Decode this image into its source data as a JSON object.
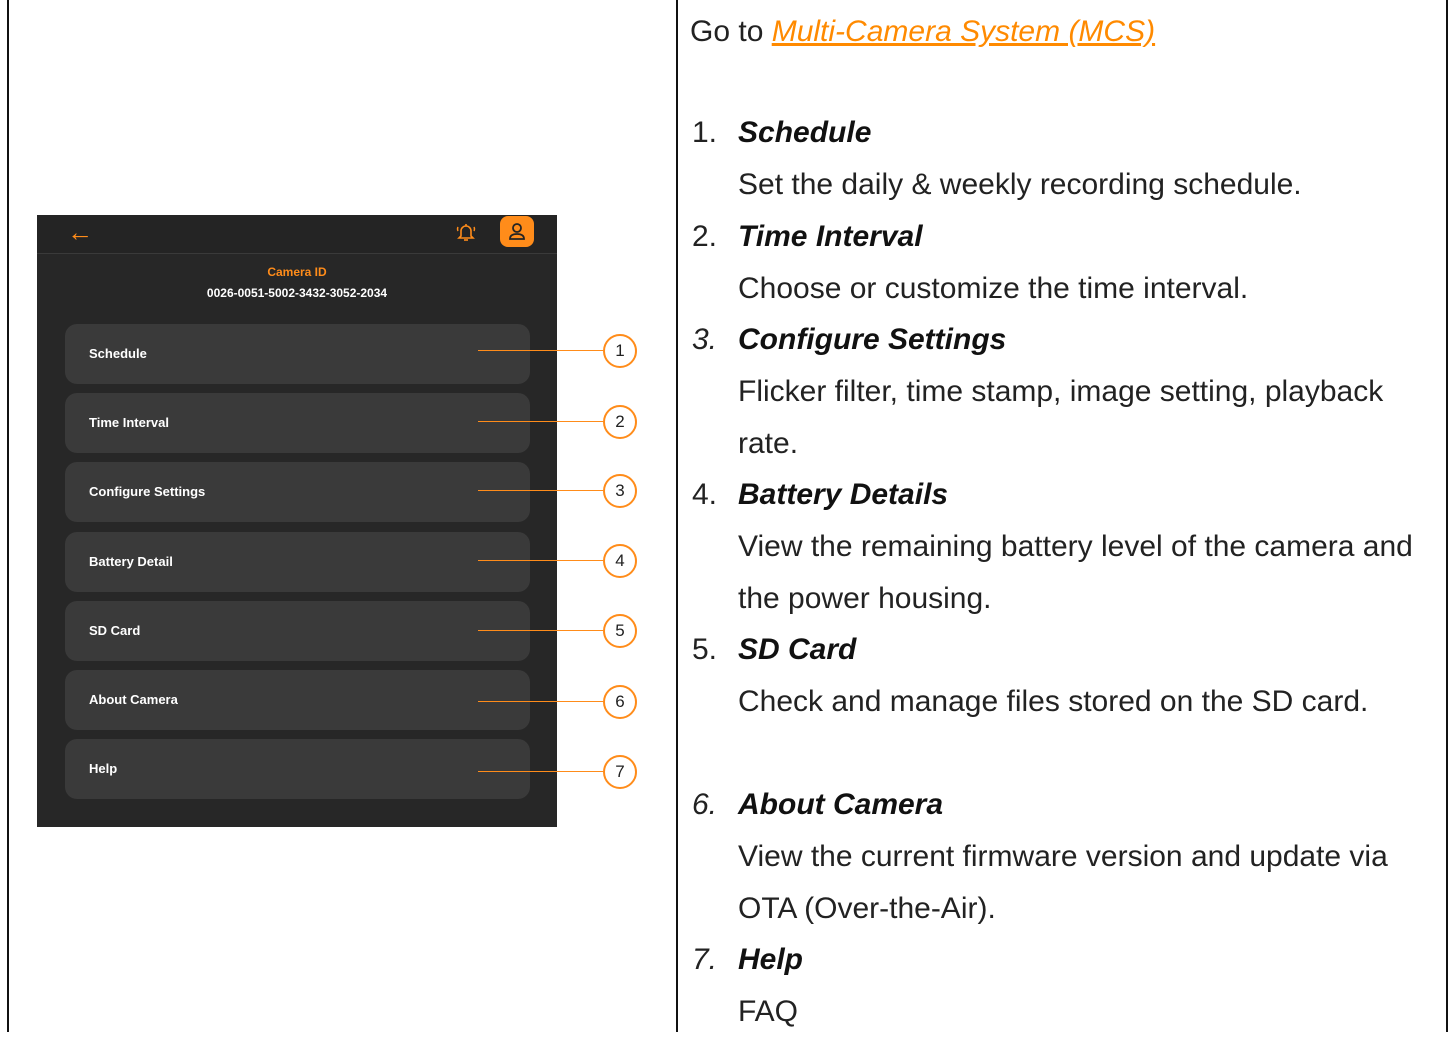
{
  "phone": {
    "camera_id_label": "Camera ID",
    "camera_id_value": "0026-0051-5002-3432-3052-2034",
    "back_icon": "arrow-left-icon",
    "alarm_icon": "bell-ring-icon",
    "profile_icon": "user-icon",
    "accent_color": "#ff8c1a",
    "menu": [
      {
        "label": "Schedule",
        "callout": "1"
      },
      {
        "label": "Time Interval",
        "callout": "2"
      },
      {
        "label": "Configure Settings",
        "callout": "3"
      },
      {
        "label": "Battery Detail",
        "callout": "4"
      },
      {
        "label": "SD Card",
        "callout": "5"
      },
      {
        "label": "About Camera",
        "callout": "6"
      },
      {
        "label": "Help",
        "callout": "7"
      }
    ]
  },
  "doc": {
    "goto_prefix": "Go to ",
    "goto_link": "Multi-Camera System (MCS)",
    "items": [
      {
        "num": "1.",
        "title": "Schedule",
        "desc": "Set the daily & weekly recording schedule."
      },
      {
        "num": "2.",
        "title": "Time Interval",
        "desc": "Choose or customize the time interval."
      },
      {
        "num": "3.",
        "title": "Configure Settings",
        "desc": "Flicker filter, time stamp, image setting, playback rate."
      },
      {
        "num": "4.",
        "title": "Battery Details",
        "desc": "View the remaining battery level of the camera and the power housing."
      },
      {
        "num": "5.",
        "title": "SD Card",
        "desc": "Check and manage files stored on the SD card."
      },
      {
        "num": "6.",
        "title": "About Camera",
        "desc": "View the current firmware version and update via OTA (Over-the-Air)."
      },
      {
        "num": "7.",
        "title": "Help",
        "desc": "FAQ"
      }
    ]
  }
}
